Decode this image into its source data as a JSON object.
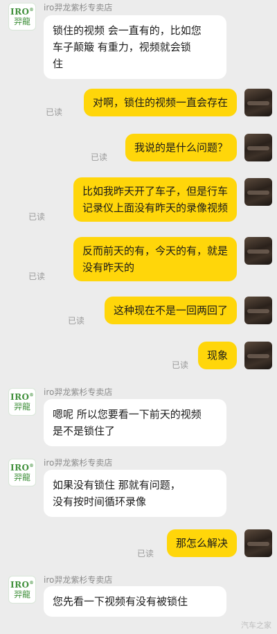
{
  "shop_name": "iro羿龙紫杉专卖店",
  "avatar": {
    "logo_top": "IRO",
    "logo_mark": "®",
    "logo_bottom": "羿龍"
  },
  "read_label": "已读",
  "messages": [
    {
      "from": "shop",
      "text": "锁住的视频 会一直有的，比如您\n车子颠簸 有重力，视频就会锁\n住"
    },
    {
      "from": "me",
      "text": "对啊，锁住的视频一直会存在"
    },
    {
      "from": "me",
      "text": "我说的是什么问题？"
    },
    {
      "from": "me",
      "text": "比如我昨天开了车子，但是行车\n记录仪上面没有昨天的录像视频"
    },
    {
      "from": "me",
      "text": "反而前天的有，今天的有，就是\n没有昨天的"
    },
    {
      "from": "me",
      "text": "这种现在不是一回两回了"
    },
    {
      "from": "me",
      "text": "现象"
    },
    {
      "from": "shop",
      "text": "嗯呢 所以您要看一下前天的视频\n是不是锁住了"
    },
    {
      "from": "shop",
      "text": "如果没有锁住  那就有问题，\n没有按时间循环录像"
    },
    {
      "from": "me",
      "text": "那怎么解决"
    },
    {
      "from": "shop",
      "text": "您先看一下视频有没有被锁住"
    }
  ],
  "watermark": "汽车之家",
  "colors": {
    "outgoing_bubble": "#ffd60a",
    "incoming_bubble": "#ffffff",
    "background": "#ececec"
  }
}
